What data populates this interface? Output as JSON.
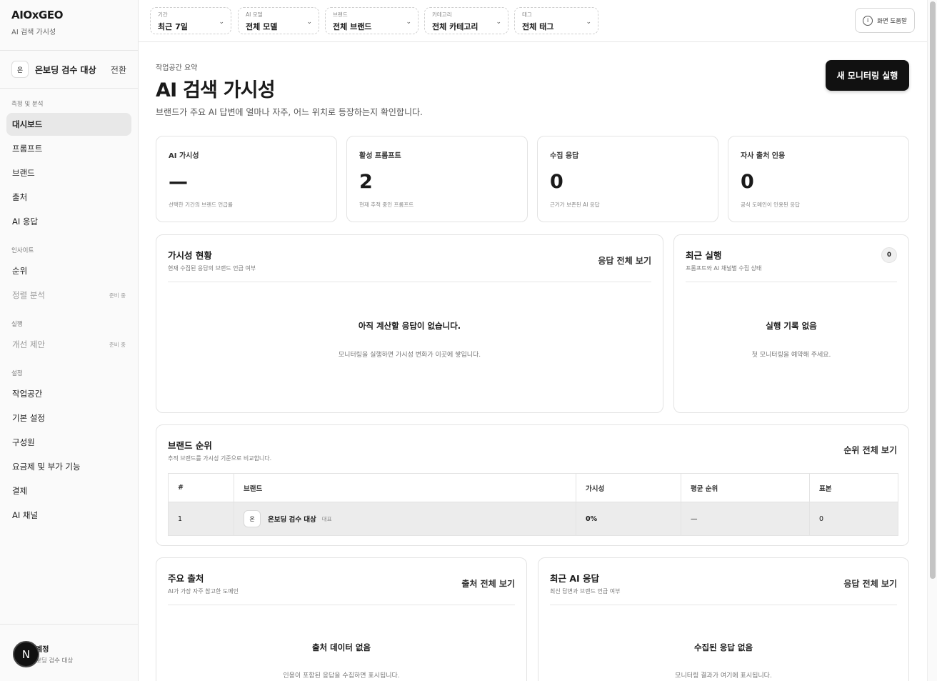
{
  "app": {
    "name": "AIOxGEO",
    "subtitle": "AI 검색 가시성"
  },
  "workspace": {
    "avatar": "온",
    "name": "온보딩 검수 대상",
    "switch_label": "전환"
  },
  "sidebar": {
    "sections": [
      {
        "title": "측정 및 분석",
        "items": [
          {
            "label": "대시보드",
            "active": true
          },
          {
            "label": "프롬프트"
          },
          {
            "label": "브랜드"
          },
          {
            "label": "출처"
          },
          {
            "label": "AI 응답"
          }
        ]
      },
      {
        "title": "인사이트",
        "items": [
          {
            "label": "순위"
          },
          {
            "label": "정렬 분석",
            "badge": "준비 중",
            "disabled": true
          }
        ]
      },
      {
        "title": "실행",
        "items": [
          {
            "label": "개선 제안",
            "badge": "준비 중",
            "disabled": true
          }
        ]
      },
      {
        "title": "설정",
        "items": [
          {
            "label": "작업공간"
          },
          {
            "label": "기본 설정"
          },
          {
            "label": "구성원"
          },
          {
            "label": "요금제 및 부가 기능"
          },
          {
            "label": "결제"
          },
          {
            "label": "AI 채널"
          }
        ]
      }
    ]
  },
  "account": {
    "avatar": "N",
    "title": "계정",
    "subtitle": "보딩 검수 대상"
  },
  "filters": [
    {
      "label": "기간",
      "value": "최근 7일"
    },
    {
      "label": "AI 모델",
      "value": "전체 모델"
    },
    {
      "label": "브랜드",
      "value": "전체 브랜드"
    },
    {
      "label": "카테고리",
      "value": "전체 카테고리"
    },
    {
      "label": "태그",
      "value": "전체 태그"
    }
  ],
  "help": {
    "icon": "i",
    "label": "화면 도움말"
  },
  "header": {
    "eyebrow": "작업공간 요약",
    "title": "AI 검색 가시성",
    "description": "브랜드가 주요 AI 답변에 얼마나 자주, 어느 위치로 등장하는지 확인합니다.",
    "primary_action": "새 모니터링 실행"
  },
  "stats": [
    {
      "label": "AI 가시성",
      "value": "—",
      "note": "선택한 기간의 브랜드 언급률"
    },
    {
      "label": "활성 프롬프트",
      "value": "2",
      "note": "현재 추적 중인 프롬프트"
    },
    {
      "label": "수집 응답",
      "value": "0",
      "note": "근거가 보존된 AI 응답"
    },
    {
      "label": "자사 출처 인용",
      "value": "0",
      "note": "공식 도메인이 인용된 응답"
    }
  ],
  "visibility_panel": {
    "title": "가시성 현황",
    "subtitle": "현재 수집된 응답의 브랜드 언급 여부",
    "link": "응답 전체 보기",
    "empty_title": "아직 계산할 응답이 없습니다.",
    "empty_sub": "모니터링을 실행하면 가시성 변화가 이곳에 쌓입니다."
  },
  "recent_runs": {
    "title": "최근 실행",
    "subtitle": "프롬프트와 AI 채널별 수집 상태",
    "count": "0",
    "empty_title": "실행 기록 없음",
    "empty_sub": "첫 모니터링을 예약해 주세요."
  },
  "brand_ranking": {
    "title": "브랜드 순위",
    "subtitle": "추적 브랜드를 가시성 기준으로 비교합니다.",
    "link": "순위 전체 보기",
    "columns": [
      "#",
      "브랜드",
      "가시성",
      "평균 순위",
      "표본"
    ],
    "rows": [
      {
        "rank": "1",
        "avatar": "온",
        "brand": "온보딩 검수 대상",
        "tag": "대표",
        "visibility": "0%",
        "avg_rank": "—",
        "sample": "0"
      }
    ]
  },
  "top_sources": {
    "title": "주요 출처",
    "subtitle": "AI가 가장 자주 참고한 도메인",
    "link": "출처 전체 보기",
    "empty_title": "출처 데이터 없음",
    "empty_sub": "인용이 포함된 응답을 수집하면 표시됩니다."
  },
  "recent_responses": {
    "title": "최근 AI 응답",
    "subtitle": "최신 답변과 브랜드 언급 여부",
    "link": "응답 전체 보기",
    "empty_title": "수집된 응답 없음",
    "empty_sub": "모니터링 결과가 여기에 표시됩니다."
  }
}
